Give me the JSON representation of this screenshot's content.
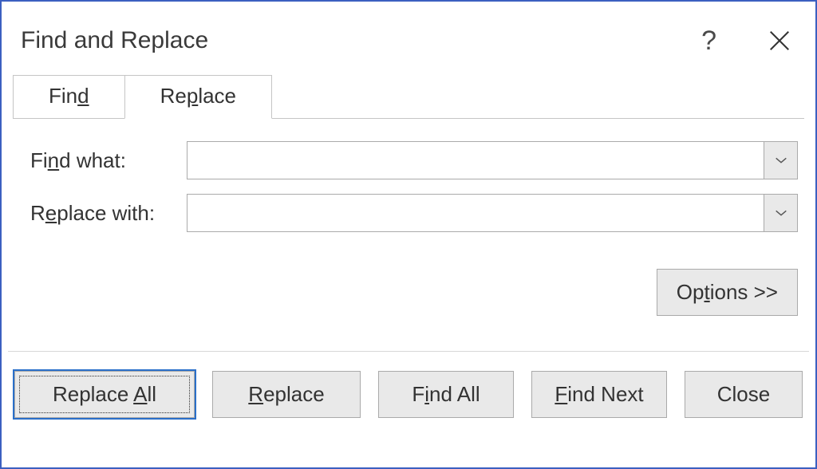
{
  "title": "Find and Replace",
  "help_tooltip": "?",
  "tabs": {
    "find": {
      "pre": "Fin",
      "u": "d",
      "post": ""
    },
    "replace": {
      "pre": "Re",
      "u": "p",
      "post": "lace"
    }
  },
  "fields": {
    "find_what": {
      "label_pre": "Fi",
      "label_u": "n",
      "label_post": "d what:",
      "value": ""
    },
    "replace_with": {
      "label_pre": "R",
      "label_u": "e",
      "label_post": "place with:",
      "value": ""
    }
  },
  "options_btn": {
    "pre": "Op",
    "u": "t",
    "post": "ions >>"
  },
  "buttons": {
    "replace_all": {
      "pre": "Replace ",
      "u": "A",
      "post": "ll"
    },
    "replace": {
      "pre": "",
      "u": "R",
      "post": "eplace"
    },
    "find_all": {
      "pre": "F",
      "u": "i",
      "post": "nd All"
    },
    "find_next": {
      "pre": "",
      "u": "F",
      "post": "ind Next"
    },
    "close": {
      "pre": "Close",
      "u": "",
      "post": ""
    }
  }
}
